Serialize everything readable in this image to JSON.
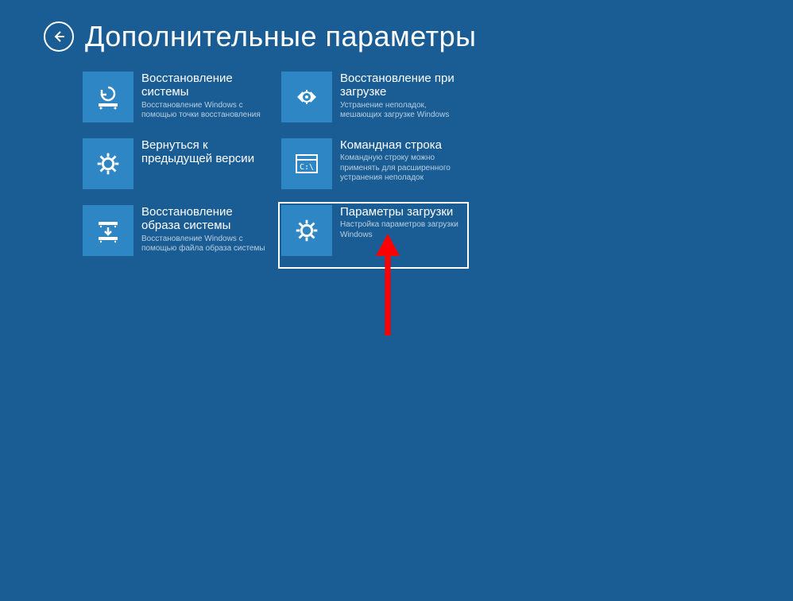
{
  "title": "Дополнительные параметры",
  "tiles": [
    {
      "title": "Восстановление системы",
      "desc": "Восстановление Windows с помощью точки восстановления",
      "icon": "restore"
    },
    {
      "title": "Восстановление при загрузке",
      "desc": "Устранение неполадок, мешающих загрузке Windows",
      "icon": "startup"
    },
    {
      "title": "Вернуться к предыдущей версии",
      "desc": "",
      "icon": "gear"
    },
    {
      "title": "Командная строка",
      "desc": "Командную строку можно применять для расширенного устранения неполадок",
      "icon": "cmd"
    },
    {
      "title": "Восстановление образа системы",
      "desc": "Восстановление Windows с помощью файла образа системы",
      "icon": "image"
    },
    {
      "title": "Параметры загрузки",
      "desc": "Настройка параметров загрузки Windows",
      "icon": "gear",
      "selected": true
    }
  ],
  "annotation": {
    "arrow_color": "#ff0000"
  }
}
